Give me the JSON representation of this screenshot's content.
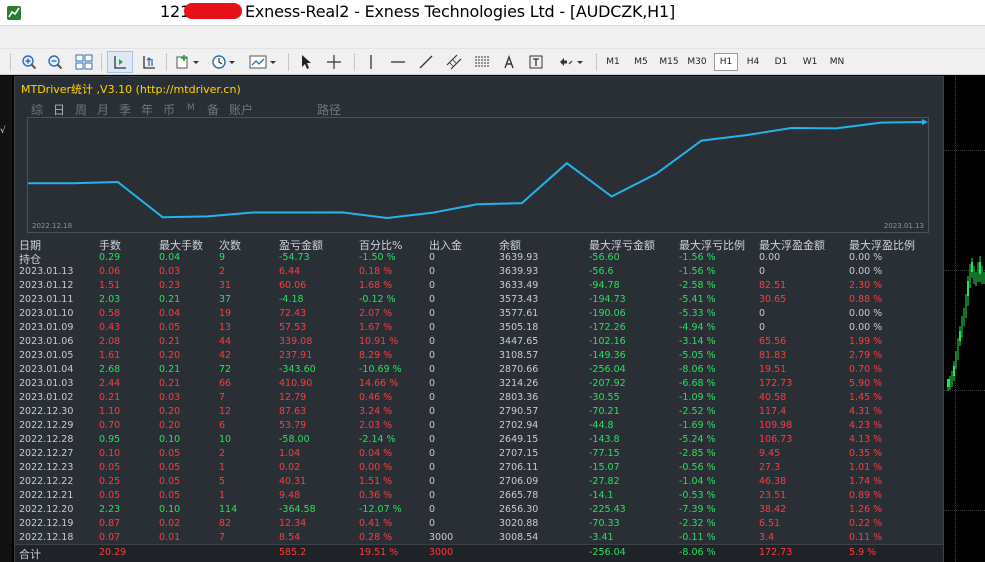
{
  "window": {
    "title_prefix": "121",
    "title_main": "Exness-Real2 - Exness Technologies Ltd - [AUDCZK,H1]"
  },
  "toolbar": {
    "timeframes": [
      "M1",
      "M5",
      "M15",
      "M30",
      "H1",
      "H4",
      "D1",
      "W1",
      "MN"
    ],
    "active_timeframe": "H1"
  },
  "panel": {
    "title": "MTDriver统计 ,V3.10 (http://mtdriver.cn)",
    "tabs": [
      "综",
      "日",
      "周",
      "月",
      "季",
      "年",
      "币",
      "M",
      "备",
      "账户",
      "路径"
    ],
    "active_tab": "日",
    "graph": {
      "start_date": "2022.12.18",
      "end_date": "2023.01.13",
      "line_color": "#1fb7ea"
    }
  },
  "table": {
    "columns": [
      "日期",
      "手数",
      "最大手数",
      "次数",
      "盈亏金额",
      "百分比%",
      "出入金",
      "余额",
      "最大浮亏金额",
      "最大浮亏比例",
      "最大浮盈金额",
      "最大浮盈比例"
    ],
    "holding_label": "持仓",
    "holding": [
      "0.29",
      "0.04",
      "9",
      "-54.73",
      "-1.50 %",
      "0",
      "3639.93",
      "-56.60",
      "-1.56 %",
      "0.00",
      "0.00 %"
    ],
    "rows": [
      {
        "date": "2023.01.13",
        "lots": "0.06",
        "max_lots": "0.03",
        "count": "2",
        "pnl": "6.44",
        "pct": "0.18 %",
        "io": "0",
        "balance": "3639.93",
        "max_fl": "-56.6",
        "max_fl_pct": "-1.56 %",
        "max_fp": "0",
        "max_fp_pct": "0.00 %"
      },
      {
        "date": "2023.01.12",
        "lots": "1.51",
        "max_lots": "0.23",
        "count": "31",
        "pnl": "60.06",
        "pct": "1.68 %",
        "io": "0",
        "balance": "3633.49",
        "max_fl": "-94.78",
        "max_fl_pct": "-2.58 %",
        "max_fp": "82.51",
        "max_fp_pct": "2.30 %"
      },
      {
        "date": "2023.01.11",
        "lots": "2.03",
        "max_lots": "0.21",
        "count": "37",
        "pnl": "-4.18",
        "pct": "-0.12 %",
        "io": "0",
        "balance": "3573.43",
        "max_fl": "-194.73",
        "max_fl_pct": "-5.41 %",
        "max_fp": "30.65",
        "max_fp_pct": "0.88 %"
      },
      {
        "date": "2023.01.10",
        "lots": "0.58",
        "max_lots": "0.04",
        "count": "19",
        "pnl": "72.43",
        "pct": "2.07 %",
        "io": "0",
        "balance": "3577.61",
        "max_fl": "-190.06",
        "max_fl_pct": "-5.33 %",
        "max_fp": "0",
        "max_fp_pct": "0.00 %"
      },
      {
        "date": "2023.01.09",
        "lots": "0.43",
        "max_lots": "0.05",
        "count": "13",
        "pnl": "57.53",
        "pct": "1.67 %",
        "io": "0",
        "balance": "3505.18",
        "max_fl": "-172.26",
        "max_fl_pct": "-4.94 %",
        "max_fp": "0",
        "max_fp_pct": "0.00 %"
      },
      {
        "date": "2023.01.06",
        "lots": "2.08",
        "max_lots": "0.21",
        "count": "44",
        "pnl": "339.08",
        "pct": "10.91 %",
        "io": "0",
        "balance": "3447.65",
        "max_fl": "-102.16",
        "max_fl_pct": "-3.14 %",
        "max_fp": "65.56",
        "max_fp_pct": "1.99 %"
      },
      {
        "date": "2023.01.05",
        "lots": "1.61",
        "max_lots": "0.20",
        "count": "42",
        "pnl": "237.91",
        "pct": "8.29 %",
        "io": "0",
        "balance": "3108.57",
        "max_fl": "-149.36",
        "max_fl_pct": "-5.05 %",
        "max_fp": "81.83",
        "max_fp_pct": "2.79 %"
      },
      {
        "date": "2023.01.04",
        "lots": "2.68",
        "max_lots": "0.21",
        "count": "72",
        "pnl": "-343.60",
        "pct": "-10.69 %",
        "io": "0",
        "balance": "2870.66",
        "max_fl": "-256.04",
        "max_fl_pct": "-8.06 %",
        "max_fp": "19.51",
        "max_fp_pct": "0.70 %"
      },
      {
        "date": "2023.01.03",
        "lots": "2.44",
        "max_lots": "0.21",
        "count": "66",
        "pnl": "410.90",
        "pct": "14.66 %",
        "io": "0",
        "balance": "3214.26",
        "max_fl": "-207.92",
        "max_fl_pct": "-6.68 %",
        "max_fp": "172.73",
        "max_fp_pct": "5.90 %"
      },
      {
        "date": "2023.01.02",
        "lots": "0.21",
        "max_lots": "0.03",
        "count": "7",
        "pnl": "12.79",
        "pct": "0.46 %",
        "io": "0",
        "balance": "2803.36",
        "max_fl": "-30.55",
        "max_fl_pct": "-1.09 %",
        "max_fp": "40.58",
        "max_fp_pct": "1.45 %"
      },
      {
        "date": "2022.12.30",
        "lots": "1.10",
        "max_lots": "0.20",
        "count": "12",
        "pnl": "87.63",
        "pct": "3.24 %",
        "io": "0",
        "balance": "2790.57",
        "max_fl": "-70.21",
        "max_fl_pct": "-2.52 %",
        "max_fp": "117.4",
        "max_fp_pct": "4.31 %"
      },
      {
        "date": "2022.12.29",
        "lots": "0.70",
        "max_lots": "0.20",
        "count": "6",
        "pnl": "53.79",
        "pct": "2.03 %",
        "io": "0",
        "balance": "2702.94",
        "max_fl": "-44.8",
        "max_fl_pct": "-1.69 %",
        "max_fp": "109.98",
        "max_fp_pct": "4.23 %"
      },
      {
        "date": "2022.12.28",
        "lots": "0.95",
        "max_lots": "0.10",
        "count": "10",
        "pnl": "-58.00",
        "pct": "-2.14 %",
        "io": "0",
        "balance": "2649.15",
        "max_fl": "-143.8",
        "max_fl_pct": "-5.24 %",
        "max_fp": "106.73",
        "max_fp_pct": "4.13 %"
      },
      {
        "date": "2022.12.27",
        "lots": "0.10",
        "max_lots": "0.05",
        "count": "2",
        "pnl": "1.04",
        "pct": "0.04 %",
        "io": "0",
        "balance": "2707.15",
        "max_fl": "-77.15",
        "max_fl_pct": "-2.85 %",
        "max_fp": "9.45",
        "max_fp_pct": "0.35 %"
      },
      {
        "date": "2022.12.23",
        "lots": "0.05",
        "max_lots": "0.05",
        "count": "1",
        "pnl": "0.02",
        "pct": "0.00 %",
        "io": "0",
        "balance": "2706.11",
        "max_fl": "-15.07",
        "max_fl_pct": "-0.56 %",
        "max_fp": "27.3",
        "max_fp_pct": "1.01 %"
      },
      {
        "date": "2022.12.22",
        "lots": "0.25",
        "max_lots": "0.05",
        "count": "5",
        "pnl": "40.31",
        "pct": "1.51 %",
        "io": "0",
        "balance": "2706.09",
        "max_fl": "-27.82",
        "max_fl_pct": "-1.04 %",
        "max_fp": "46.38",
        "max_fp_pct": "1.74 %"
      },
      {
        "date": "2022.12.21",
        "lots": "0.05",
        "max_lots": "0.05",
        "count": "1",
        "pnl": "9.48",
        "pct": "0.36 %",
        "io": "0",
        "balance": "2665.78",
        "max_fl": "-14.1",
        "max_fl_pct": "-0.53 %",
        "max_fp": "23.51",
        "max_fp_pct": "0.89 %"
      },
      {
        "date": "2022.12.20",
        "lots": "2.23",
        "max_lots": "0.10",
        "count": "114",
        "pnl": "-364.58",
        "pct": "-12.07 %",
        "io": "0",
        "balance": "2656.30",
        "max_fl": "-225.43",
        "max_fl_pct": "-7.39 %",
        "max_fp": "38.42",
        "max_fp_pct": "1.26 %"
      },
      {
        "date": "2022.12.19",
        "lots": "0.87",
        "max_lots": "0.02",
        "count": "82",
        "pnl": "12.34",
        "pct": "0.41 %",
        "io": "0",
        "balance": "3020.88",
        "max_fl": "-70.33",
        "max_fl_pct": "-2.32 %",
        "max_fp": "6.51",
        "max_fp_pct": "0.22 %"
      },
      {
        "date": "2022.12.18",
        "lots": "0.07",
        "max_lots": "0.01",
        "count": "7",
        "pnl": "8.54",
        "pct": "0.28 %",
        "io": "3000",
        "balance": "3008.54",
        "max_fl": "-3.41",
        "max_fl_pct": "-0.11 %",
        "max_fp": "3.4",
        "max_fp_pct": "0.11 %"
      }
    ],
    "total_label": "合计",
    "total": [
      "20.29",
      "",
      "",
      "585.2",
      "19.51 %",
      "3000",
      "",
      "-256.04",
      "-8.06 %",
      "172.73",
      "5.9 %"
    ]
  }
}
